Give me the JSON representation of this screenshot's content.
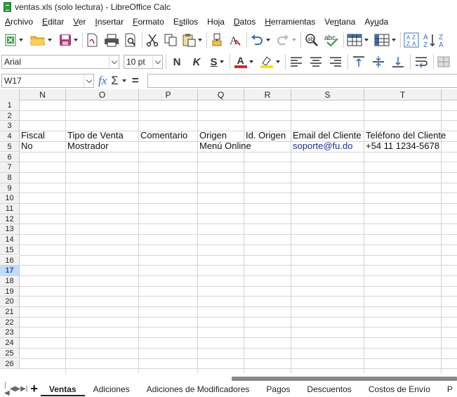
{
  "window": {
    "title": "ventas.xls (solo lectura) - LibreOffice Calc"
  },
  "menu": [
    {
      "pre": "",
      "ul": "A",
      "post": "rchivo"
    },
    {
      "pre": "",
      "ul": "E",
      "post": "ditar"
    },
    {
      "pre": "",
      "ul": "V",
      "post": "er"
    },
    {
      "pre": "",
      "ul": "I",
      "post": "nsertar"
    },
    {
      "pre": "",
      "ul": "F",
      "post": "ormato"
    },
    {
      "pre": "E",
      "ul": "s",
      "post": "tilos"
    },
    {
      "pre": "Ho",
      "ul": "j",
      "post": "a"
    },
    {
      "pre": "",
      "ul": "D",
      "post": "atos"
    },
    {
      "pre": "",
      "ul": "H",
      "post": "erramientas"
    },
    {
      "pre": "Ve",
      "ul": "n",
      "post": "tana"
    },
    {
      "pre": "Ay",
      "ul": "u",
      "post": "da"
    }
  ],
  "format": {
    "font_name": "Arial",
    "font_size": "10 pt",
    "bold_label": "N",
    "italic_label": "K",
    "underline_label": "S",
    "font_color_label": "A",
    "font_color": "#d22d2d",
    "highlight_color": "#f7e600"
  },
  "formula_bar": {
    "cell_ref": "W17",
    "fx_label": "fx",
    "sum_label": "Σ",
    "equals_label": "=",
    "content": ""
  },
  "grid": {
    "columns": [
      "N",
      "O",
      "P",
      "Q",
      "R",
      "S",
      "T"
    ],
    "rows": [
      "1",
      "2",
      "3",
      "4",
      "5",
      "6",
      "7",
      "8",
      "9",
      "10",
      "11",
      "12",
      "13",
      "14",
      "15",
      "16",
      "17",
      "18",
      "19",
      "20",
      "21",
      "22",
      "23",
      "24",
      "25",
      "26"
    ],
    "active_row": "17",
    "row4": {
      "N": "Fiscal",
      "O": "Tipo de Venta",
      "P": "Comentario",
      "Q": "Origen",
      "R": "Id. Origen",
      "S": "Email del Cliente",
      "T": "Teléfono del Cliente"
    },
    "row5": {
      "N": "No",
      "O": "Mostrador",
      "P": "",
      "Q": "Menú Online",
      "R": "",
      "S": "soporte@fu.do",
      "T": "+54 11 1234-5678"
    }
  },
  "sheet_tabs": {
    "active": "Ventas",
    "items": [
      "Ventas",
      "Adiciones",
      "Adiciones de Modificadores",
      "Pagos",
      "Descuentos",
      "Costos de Envío",
      "P"
    ]
  }
}
